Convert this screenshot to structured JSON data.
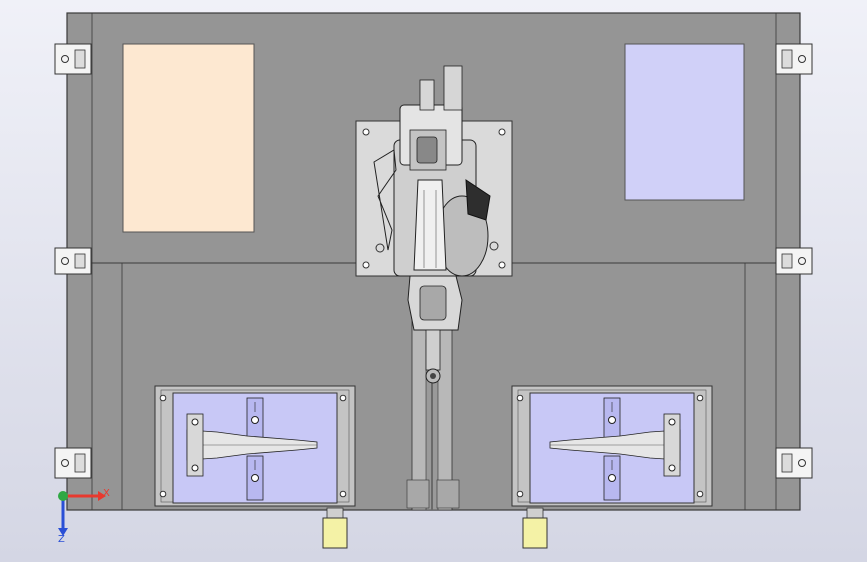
{
  "viewport": {
    "background_top": "#f0f1f8",
    "background_bottom": "#d4d6e4"
  },
  "colors": {
    "frame_fill": "#959595",
    "frame_stroke": "#3a3a3a",
    "panel_left": "#fde8d1",
    "panel_right": "#d0d0f8",
    "fixture_plate": "#c8c8f6",
    "clamp_blue": "#b8b8f0",
    "rail_steel": "#b8b8b8",
    "robot_base": "#dadada",
    "cable_yellow": "#f4f2a6",
    "axis_x": "#e8392e",
    "axis_y": "#2fa843",
    "axis_z": "#2a4fd6"
  },
  "triad": {
    "x_label": "X",
    "z_label": "Z"
  },
  "icons": {
    "triad": "coordinate-triad-icon",
    "robot": "industrial-robot-arm-icon",
    "fixture": "welding-fixture-icon",
    "clamp": "clamp-icon",
    "bracket": "corner-bracket-icon",
    "connector": "cable-connector-icon"
  }
}
